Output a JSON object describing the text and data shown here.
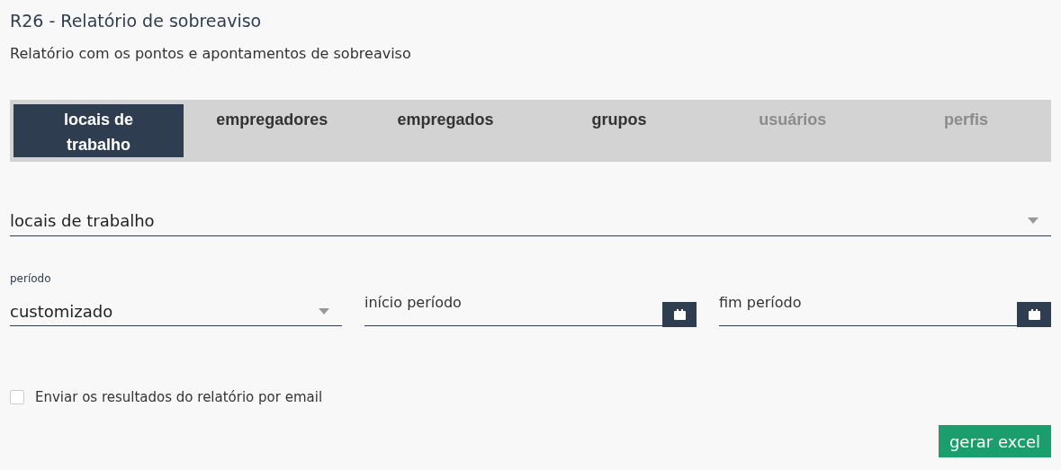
{
  "header": {
    "title": "R26 - Relatório de sobreaviso",
    "subtitle": "Relatório com os pontos e apontamentos de sobreaviso"
  },
  "tabs": [
    {
      "label": "locais de trabalho",
      "selected": true,
      "disabled": false
    },
    {
      "label": "empregadores",
      "selected": false,
      "disabled": false
    },
    {
      "label": "empregados",
      "selected": false,
      "disabled": false
    },
    {
      "label": "grupos",
      "selected": false,
      "disabled": false
    },
    {
      "label": "usuários",
      "selected": false,
      "disabled": true
    },
    {
      "label": "perfis",
      "selected": false,
      "disabled": true
    }
  ],
  "locations_select": {
    "value": "locais de trabalho"
  },
  "period": {
    "label": "período",
    "value": "customizado"
  },
  "start_date": {
    "placeholder": "início período"
  },
  "end_date": {
    "placeholder": "fim período"
  },
  "email_option": {
    "label": "Enviar os resultados do relatório por email",
    "checked": false
  },
  "export_button": {
    "label": "gerar excel"
  }
}
